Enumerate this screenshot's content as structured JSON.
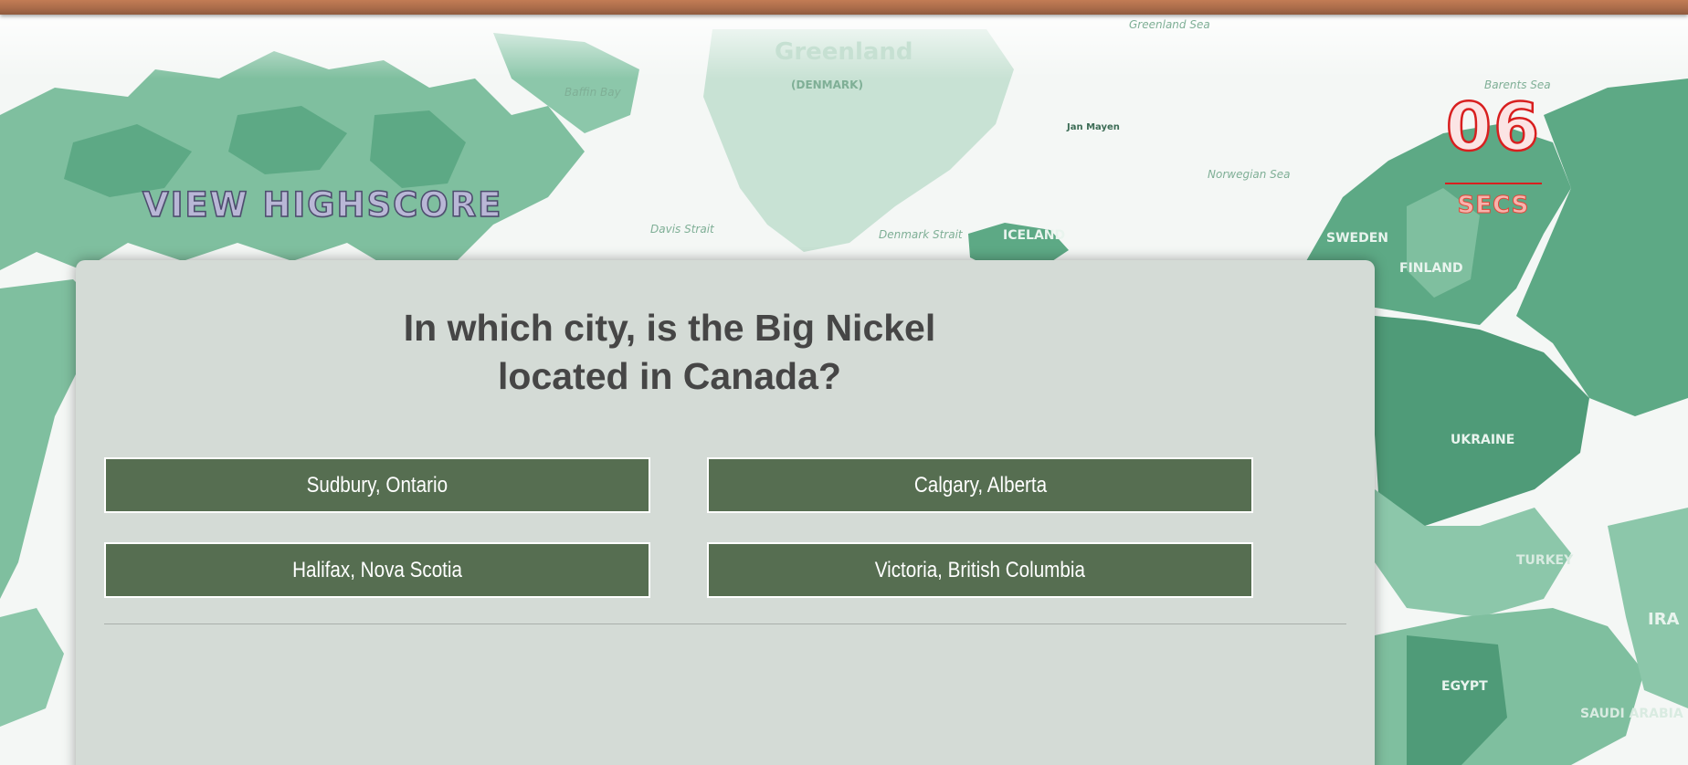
{
  "background_map": {
    "labels": [
      "Greenland",
      "(DENMARK)",
      "Greenland Sea",
      "Baffin Bay",
      "Jan Mayen",
      "Norwegian Sea",
      "Barents Sea",
      "Davis Strait",
      "Denmark Strait",
      "ICELAND",
      "SWEDEN",
      "FINLAND",
      "UKRAINE",
      "TURKEY",
      "EGYPT",
      "SAUDI ARABIA",
      "IRA"
    ],
    "land_color": "#5da985",
    "water_color": "#f4f7f5"
  },
  "header": {
    "view_highscore_label": "VIEW HIGHSCORE"
  },
  "timer": {
    "value": "06",
    "unit": "SECS",
    "color": "#d81f1f"
  },
  "quiz": {
    "question": "In which city, is the Big Nickel located in Canada?",
    "answers": [
      {
        "label": "Sudbury, Ontario"
      },
      {
        "label": "Calgary, Alberta"
      },
      {
        "label": "Halifax, Nova Scotia"
      },
      {
        "label": "Victoria, British Columbia"
      }
    ],
    "answer_bg": "#566e51",
    "card_bg": "#d4dbd6"
  }
}
